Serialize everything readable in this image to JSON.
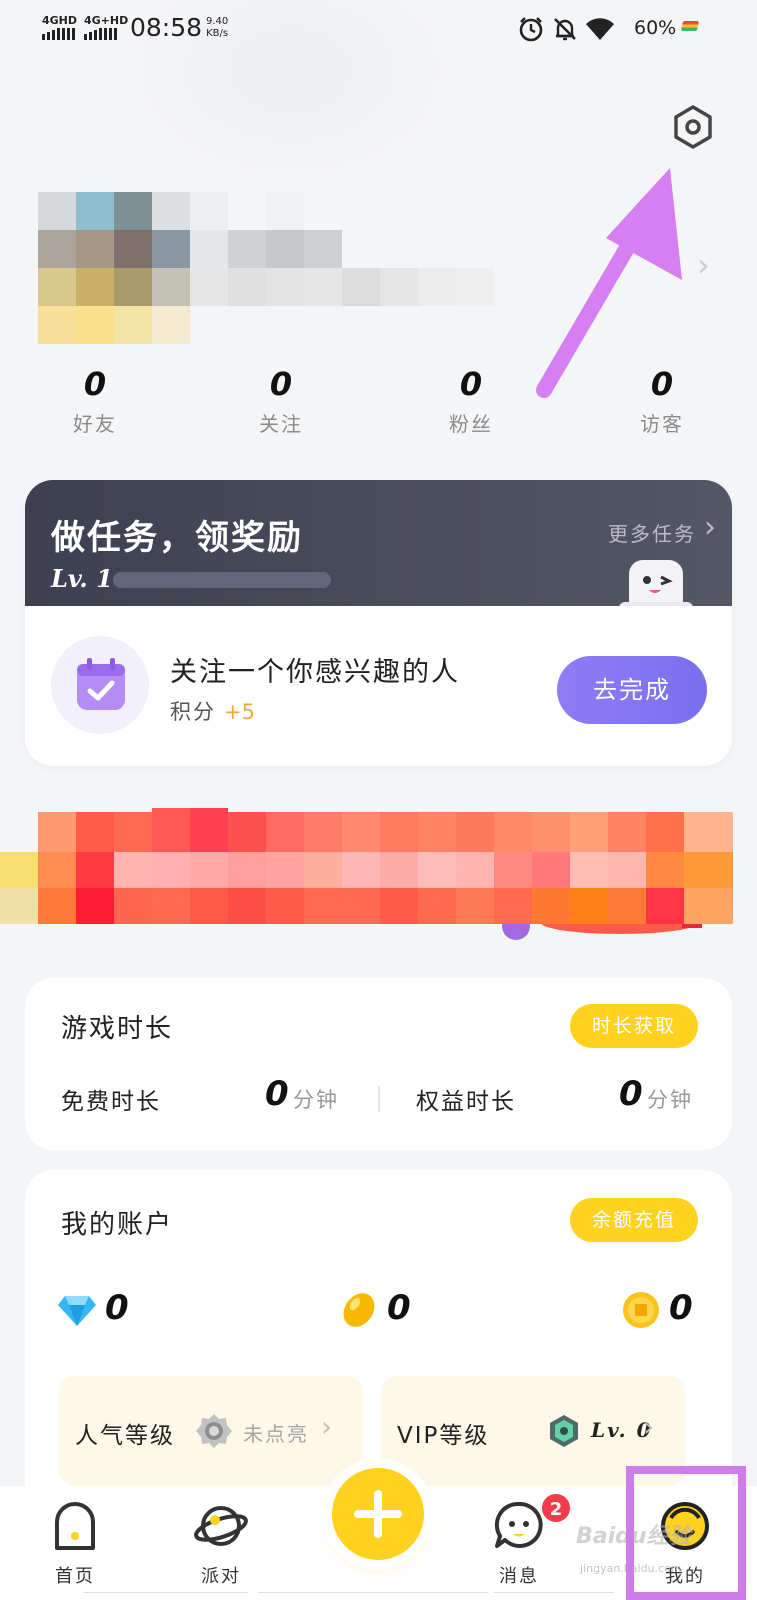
{
  "status_bar": {
    "signal_1": "4GHD",
    "signal_2": "4G+HD",
    "time": "08:58",
    "speed_value": "9.40",
    "speed_unit": "KB/s",
    "battery": "60%",
    "icons": [
      "alarm-icon",
      "mute-icon",
      "wifi-icon",
      "battery-icon"
    ]
  },
  "profile": {
    "stats": [
      {
        "value": "0",
        "label": "好友"
      },
      {
        "value": "0",
        "label": "关注"
      },
      {
        "value": "0",
        "label": "粉丝"
      },
      {
        "value": "0",
        "label": "访客"
      }
    ]
  },
  "task": {
    "title": "做任务，领奖励",
    "more": "更多任务",
    "level": "Lv. 1",
    "name": "关注一个你感兴趣的人",
    "points_label": "积分",
    "points_value": "+5",
    "action": "去完成"
  },
  "game_time": {
    "title": "游戏时长",
    "action": "时长获取",
    "free_label": "免费时长",
    "free_value": "0",
    "free_unit": "分钟",
    "rights_label": "权益时长",
    "rights_value": "0",
    "rights_unit": "分钟"
  },
  "account": {
    "title": "我的账户",
    "action": "余额充值",
    "diamonds": "0",
    "beans": "0",
    "coins": "0",
    "popularity_label": "人气等级",
    "popularity_status": "未点亮",
    "vip_label": "VIP等级",
    "vip_status": "Lv. 0"
  },
  "nav": {
    "items": [
      {
        "label": "首页",
        "icon": "home-icon"
      },
      {
        "label": "派对",
        "icon": "party-planet-icon"
      },
      {
        "label": "消息",
        "icon": "message-icon"
      },
      {
        "label": "我的",
        "icon": "profile-smile-icon"
      }
    ],
    "message_badge": "2"
  },
  "watermark": {
    "text": "Baidu经验",
    "sub": "jingyan.baidu.com"
  },
  "colors": {
    "accent_yellow": "#ffd21f",
    "accent_purple": "#7a6ff0",
    "annotation": "#cf7dea",
    "points_orange": "#f2a93b",
    "badge_red": "#f43b4c"
  }
}
